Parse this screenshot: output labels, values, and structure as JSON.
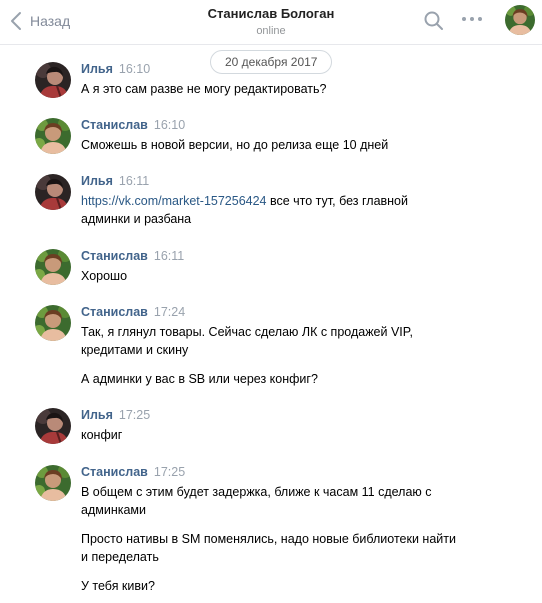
{
  "header": {
    "back_label": "Назад",
    "title": "Станислав Бологан",
    "status": "online"
  },
  "date_separator": "20 декабря 2017",
  "messages": [
    {
      "author": "Илья",
      "time": "16:10",
      "avatar": "ilya",
      "paragraphs": [
        "А я это сам разве не могу редактировать?"
      ]
    },
    {
      "author": "Станислав",
      "time": "16:10",
      "avatar": "stanislav",
      "paragraphs": [
        "Сможешь в новой версии, но до релиза еще 10 дней"
      ]
    },
    {
      "author": "Илья",
      "time": "16:11",
      "avatar": "ilya",
      "link": "https://vk.com/market-157256424",
      "link_suffix": " все что тут, без главной админки и разбана"
    },
    {
      "author": "Станислав",
      "time": "16:11",
      "avatar": "stanislav",
      "paragraphs": [
        "Хорошо"
      ]
    },
    {
      "author": "Станислав",
      "time": "17:24",
      "avatar": "stanislav",
      "paragraphs": [
        "Так, я глянул товары. Сейчас сделаю ЛК с продажей VIP, кредитами и скину",
        "А админки у вас в SB или через конфиг?"
      ]
    },
    {
      "author": "Илья",
      "time": "17:25",
      "avatar": "ilya",
      "paragraphs": [
        "конфиг"
      ]
    },
    {
      "author": "Станислав",
      "time": "17:25",
      "avatar": "stanislav",
      "paragraphs": [
        "В общем с этим будет задержка, ближе к часам 11 сделаю с админками",
        "Просто нативы в SM поменялись, надо новые библиотеки найти и переделать",
        "У тебя киви?"
      ]
    }
  ],
  "icons": {
    "back": "chevron-left-icon",
    "search": "search-icon",
    "more": "more-dots-icon"
  },
  "colors": {
    "author": "#42648b",
    "link": "#2a5885",
    "muted": "#99a2ad"
  }
}
